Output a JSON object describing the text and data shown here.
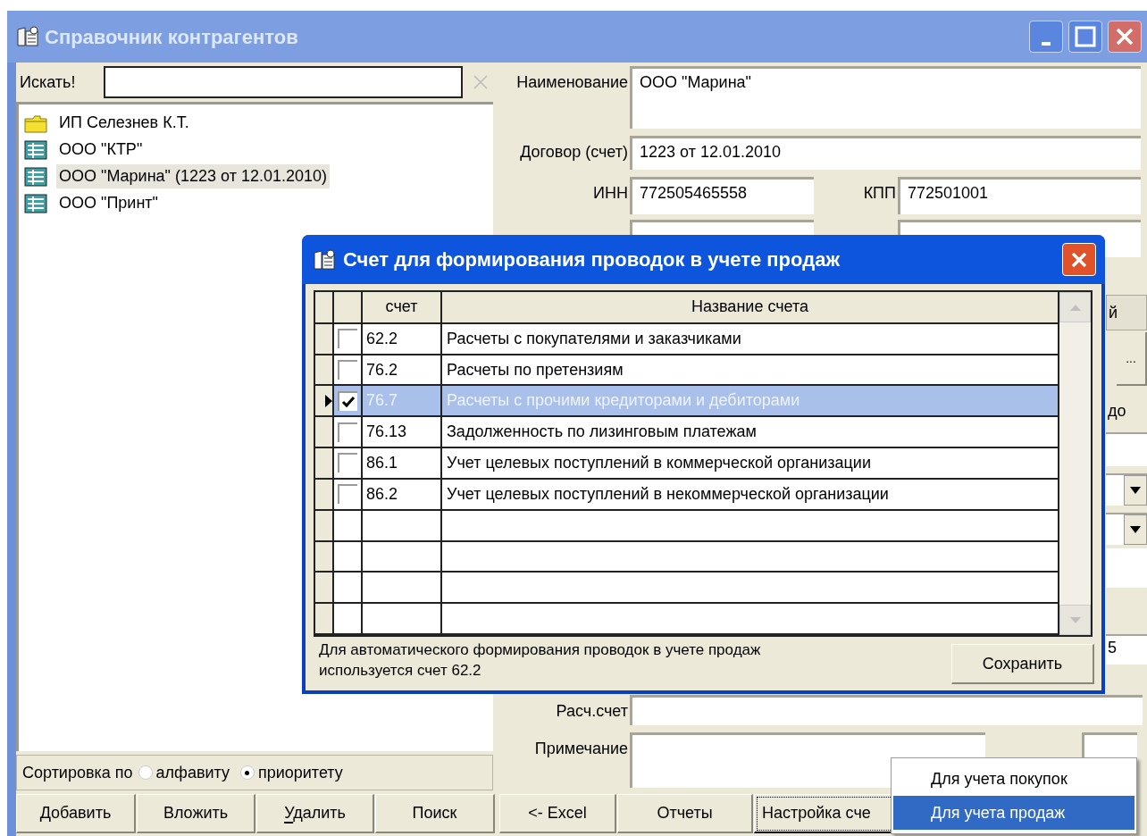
{
  "window": {
    "title": "Справочник контрагентов"
  },
  "search": {
    "label": "Искать!"
  },
  "tree": [
    {
      "label": "ИП Селезнев К.Т.",
      "kind": "folder",
      "selected": false
    },
    {
      "label": "ООО \"КТР\"",
      "kind": "record",
      "selected": false
    },
    {
      "label": "ООО \"Марина\" (1223 от 12.01.2010)",
      "kind": "record",
      "selected": true
    },
    {
      "label": "ООО \"Принт\"",
      "kind": "record",
      "selected": false
    }
  ],
  "sort": {
    "label": "Сортировка по",
    "options": [
      {
        "label": "алфавиту",
        "selected": false
      },
      {
        "label": "приоритету",
        "selected": true
      }
    ]
  },
  "form": {
    "name": {
      "label": "Наименование",
      "value": "ООО \"Марина\""
    },
    "contract": {
      "label": "Договор (счет)",
      "value": "1223 от 12.01.2010"
    },
    "inn": {
      "label": "ИНН",
      "value": "772505465558"
    },
    "kpp": {
      "label": "КПП",
      "value": "772501001"
    },
    "account": {
      "label": "Расч.счет"
    },
    "note": {
      "label": "Примечание"
    },
    "button_fragment": "й",
    "ellipsis_button": "...",
    "label_fragment": "до",
    "field_fragment": "5"
  },
  "buttons": [
    {
      "label": "Добавить",
      "mnemonic": false,
      "focused": false
    },
    {
      "label": "Вложить",
      "mnemonic": false,
      "focused": false
    },
    {
      "label": "Удалить",
      "mnemonic": true,
      "focused": false
    },
    {
      "label": "Поиск",
      "mnemonic": false,
      "focused": false
    },
    {
      "label": "<- Excel",
      "mnemonic": false,
      "focused": false
    },
    {
      "label": "Отчеты",
      "mnemonic": false,
      "focused": false
    },
    {
      "label": "Настройка сче",
      "mnemonic": false,
      "focused": true
    }
  ],
  "dialog": {
    "title": "Счет для формирования проводок в учете продаж",
    "table": {
      "columns": [
        "счет",
        "Название счета"
      ],
      "rows": [
        {
          "account": "62.2",
          "name": "Расчеты с покупателями и заказчиками",
          "checked": false,
          "selected": false
        },
        {
          "account": "76.2",
          "name": "Расчеты по претензиям",
          "checked": false,
          "selected": false
        },
        {
          "account": "76.7",
          "name": "Расчеты с прочими кредиторами и дебиторами",
          "checked": true,
          "selected": true
        },
        {
          "account": "76.13",
          "name": "Задолженность по лизинговым платежам",
          "checked": false,
          "selected": false
        },
        {
          "account": "86.1",
          "name": "Учет целевых поступлений в коммерческой организации",
          "checked": false,
          "selected": false
        },
        {
          "account": "86.2",
          "name": "Учет целевых поступлений в некоммерческой организации",
          "checked": false,
          "selected": false
        }
      ]
    },
    "footer_text": "Для автоматического формирования проводок в учете продаж используется счет 62.2",
    "save_button": "Сохранить"
  },
  "popup_menu": {
    "items": [
      {
        "label": "Для учета покупок",
        "selected": false
      },
      {
        "label": "Для учета продаж",
        "selected": true
      }
    ]
  }
}
